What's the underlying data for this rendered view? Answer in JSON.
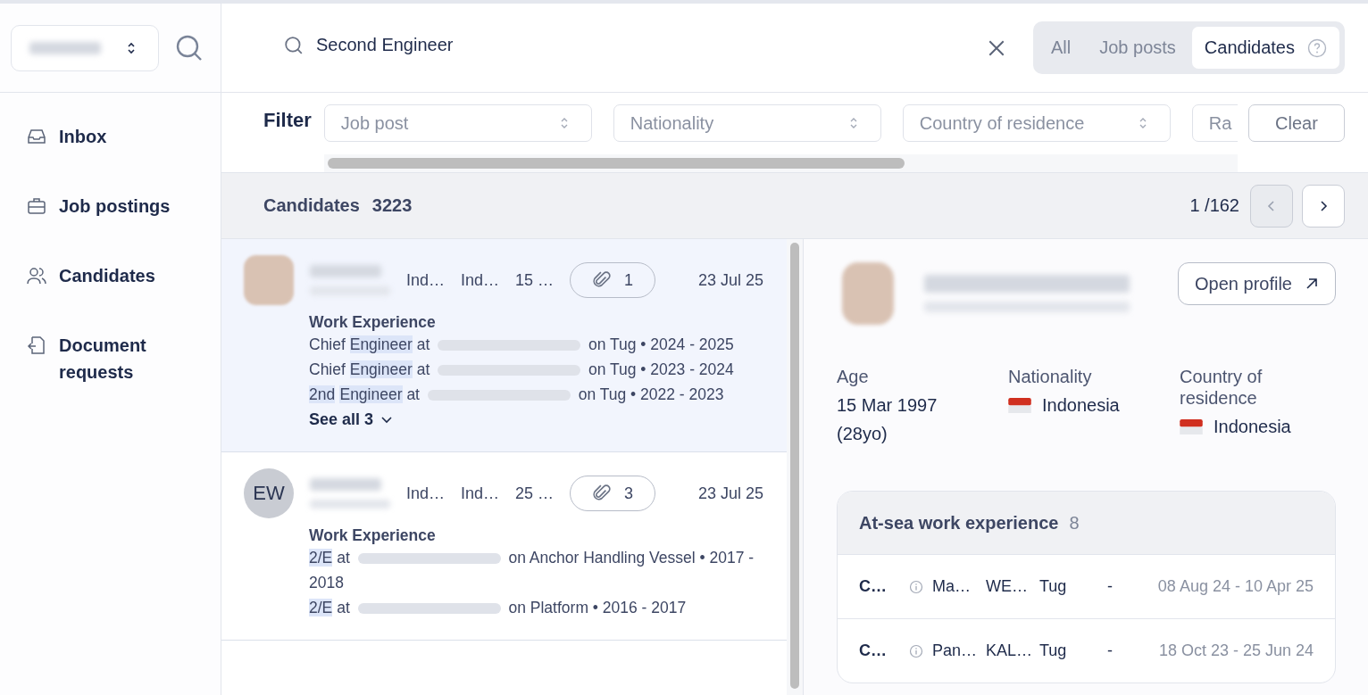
{
  "sidebar": {
    "items": [
      {
        "label": "Inbox",
        "kind": "inbox"
      },
      {
        "label": "Job postings",
        "kind": "briefcase"
      },
      {
        "label": "Candidates",
        "kind": "people"
      },
      {
        "label": "Document requests",
        "kind": "document"
      }
    ]
  },
  "search": {
    "value": "Second Engineer"
  },
  "scope_tabs": [
    {
      "label": "All",
      "selected": false,
      "help": false
    },
    {
      "label": "Job posts",
      "selected": false,
      "help": false
    },
    {
      "label": "Candidates",
      "selected": true,
      "help": true
    }
  ],
  "filters": {
    "label": "Filter",
    "dropdowns": [
      {
        "placeholder": "Job post"
      },
      {
        "placeholder": "Nationality"
      },
      {
        "placeholder": "Country of residence"
      },
      {
        "placeholder": "Ra"
      }
    ],
    "clear": "Clear"
  },
  "results": {
    "title": "Candidates",
    "count": "3223",
    "page": "1 /162",
    "prev_disabled": true
  },
  "candidates": [
    {
      "selected": true,
      "meta": [
        "Ind…",
        "Ind…",
        "15 …"
      ],
      "attachments": "1",
      "date": "23 Jul 25",
      "experience_title": "Work Experience",
      "lines": [
        [
          {
            "kind": "text",
            "text": "Chief "
          },
          {
            "kind": "highlight",
            "text": "Engineer"
          },
          {
            "kind": "text",
            "text": " at "
          },
          {
            "kind": "redacted"
          },
          {
            "kind": "text",
            "text": " on Tug • 2024 - 2025"
          }
        ],
        [
          {
            "kind": "text",
            "text": "Chief "
          },
          {
            "kind": "highlight",
            "text": "Engineer"
          },
          {
            "kind": "text",
            "text": " at "
          },
          {
            "kind": "redacted"
          },
          {
            "kind": "text",
            "text": " on Tug • 2023 - 2024"
          }
        ],
        [
          {
            "kind": "highlight",
            "text": "2nd"
          },
          {
            "kind": "space"
          },
          {
            "kind": "highlight",
            "text": "Engineer"
          },
          {
            "kind": "text",
            "text": " at "
          },
          {
            "kind": "redacted"
          },
          {
            "kind": "text",
            "text": " on Tug • 2022 - 2023"
          }
        ]
      ],
      "see_all": "See all 3"
    },
    {
      "selected": false,
      "initials": "EW",
      "meta": [
        "Ind…",
        "Ind…",
        "25 …"
      ],
      "attachments": "3",
      "date": "23 Jul 25",
      "experience_title": "Work Experience",
      "lines": [
        [
          {
            "kind": "highlight",
            "text": "2/E"
          },
          {
            "kind": "text",
            "text": " at "
          },
          {
            "kind": "redacted"
          },
          {
            "kind": "text",
            "text": " on Anchor Handling Vessel • 2017 - 2018"
          }
        ],
        [
          {
            "kind": "highlight",
            "text": "2/E"
          },
          {
            "kind": "text",
            "text": " at "
          },
          {
            "kind": "redacted"
          },
          {
            "kind": "text",
            "text": " on Platform • 2016 - 2017"
          }
        ]
      ]
    }
  ],
  "detail": {
    "open_profile": "Open profile",
    "fields": [
      {
        "label": "Age",
        "value": "15 Mar 1997 (28yo)",
        "flag": false
      },
      {
        "label": "Nationality",
        "value": "Indonesia",
        "flag": true
      },
      {
        "label": "Country of residence",
        "value": "Indonesia",
        "flag": true
      }
    ],
    "work": {
      "title": "At-sea work experience",
      "count": "8",
      "rows": [
        {
          "cells": [
            "C…",
            "Ma…",
            "WE…",
            "Tug",
            "-"
          ],
          "dates": "08 Aug 24 - 10 Apr 25"
        },
        {
          "cells": [
            "C…",
            "Pan…",
            "KAL…",
            "Tug",
            "-"
          ],
          "dates": "18 Oct 23 - 25 Jun 24"
        }
      ]
    }
  }
}
